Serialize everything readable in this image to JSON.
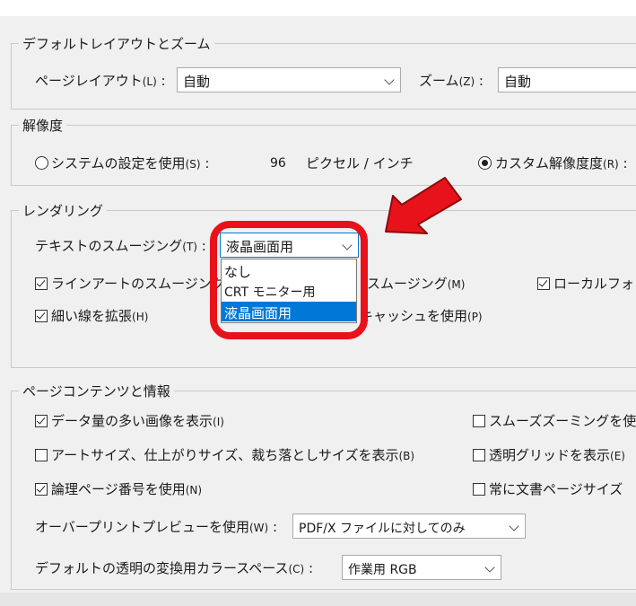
{
  "colors": {
    "accent": "#0078d7",
    "annotation": "#e8121a",
    "background": "#f0f0f0"
  },
  "default_layout": {
    "group_title": "デフォルトレイアウトとズーム",
    "page_layout_label": "ページレイアウト",
    "page_layout_key": "(L)",
    "page_layout_value": "自動",
    "zoom_label": "ズーム",
    "zoom_key": "(Z)",
    "zoom_value": "自動"
  },
  "resolution": {
    "group_title": "解像度",
    "system_option": "システムの設定を使用",
    "system_key": "(S)",
    "dpi_value": "96",
    "dpi_unit": "ピクセル / インチ",
    "custom_option": "カスタム解像度度",
    "custom_key": "(R)"
  },
  "rendering": {
    "group_title": "レンダリング",
    "text_smoothing_label": "テキストのスムージング",
    "text_smoothing_key": "(T)",
    "text_smoothing_value": "液晶画面用",
    "line_art_label": "ラインアートのスムージング",
    "image_smoothing_tail": "スムージング",
    "image_smoothing_key": "(M)",
    "local_fonts_label": "ローカルフォン",
    "thin_lines_label": "細い線を拡張",
    "thin_lines_key": "(H)",
    "cache_tail": "キャッシュを使用",
    "cache_key": "(P)",
    "dropdown_options": [
      "なし",
      "CRT モニター用",
      "液晶画面用"
    ]
  },
  "page_content": {
    "group_title": "ページコンテンツと情報",
    "large_images_label": "データ量の多い画像を表示",
    "large_images_key": "(I)",
    "smooth_zoom_label": "スムーズズーミングを使",
    "art_trim_label": "アートサイズ、仕上がりサイズ、裁ち落としサイズを表示",
    "art_trim_key": "(B)",
    "transparency_grid_label": "透明グリッドを表示",
    "transparency_grid_key": "(E)",
    "logical_page_label": "論理ページ番号を使用",
    "logical_page_key": "(N)",
    "doc_page_size_label": "常に文書ページサイズ",
    "overprint_label": "オーバープリントプレビューを使用",
    "overprint_key": "(W)",
    "overprint_value": "PDF/X ファイルに対してのみ",
    "blend_space_label": "デフォルトの透明の変換用カラースペース",
    "blend_space_key": "(C)",
    "blend_space_value": "作業用 RGB"
  }
}
